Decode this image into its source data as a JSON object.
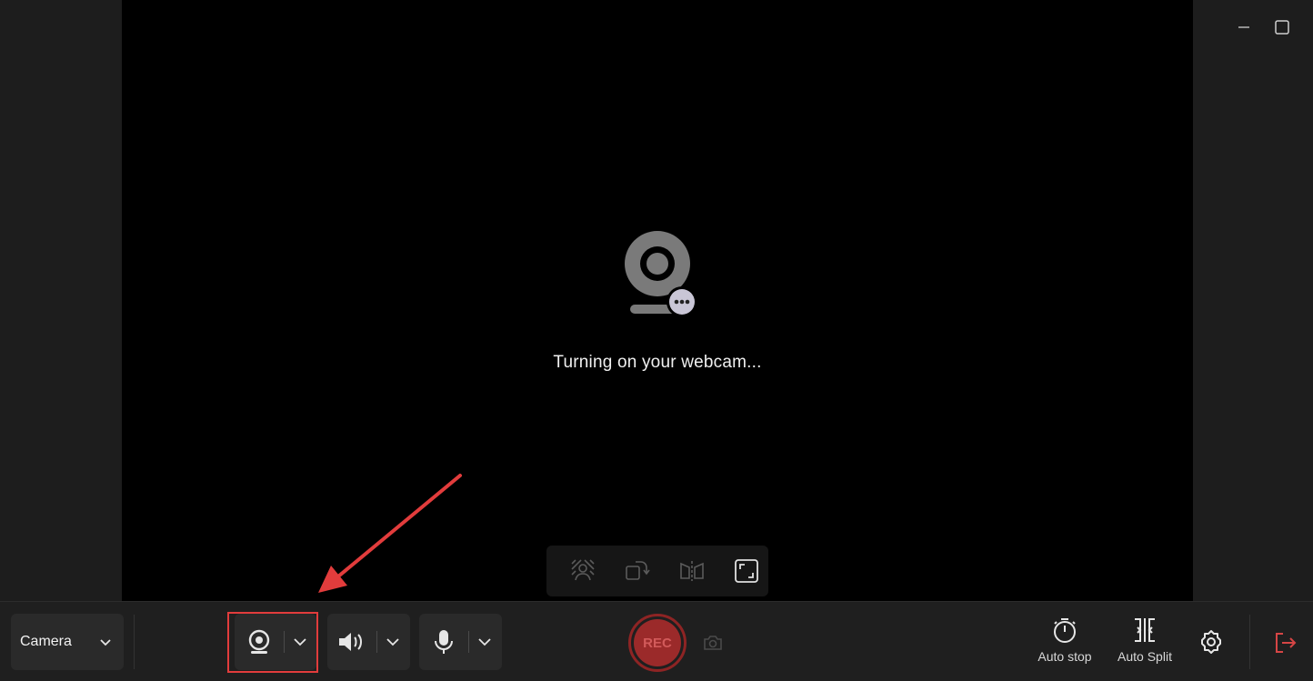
{
  "window": {
    "minimize_icon": "minimize-icon",
    "maximize_icon": "maximize-icon"
  },
  "preview": {
    "status_text": "Turning on your webcam...",
    "placeholder_icon": "webcam-loading-icon",
    "tools": [
      {
        "name": "background-blur-icon"
      },
      {
        "name": "rotate-icon"
      },
      {
        "name": "mirror-icon"
      },
      {
        "name": "fullscreen-icon"
      }
    ]
  },
  "toolbar": {
    "mode_label": "Camera",
    "webcam_icon": "webcam-icon",
    "speaker_icon": "speaker-icon",
    "mic_icon": "microphone-icon",
    "rec_label": "REC",
    "auto_stop_label": "Auto stop",
    "auto_split_label": "Auto Split",
    "settings_icon": "gear-icon",
    "exit_icon": "exit-icon"
  },
  "colors": {
    "accent_red": "#e23c3c",
    "rec_red": "#9b2a2a",
    "background": "#1b1b1b"
  }
}
